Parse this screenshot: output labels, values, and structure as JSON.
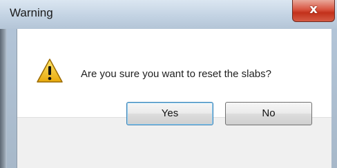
{
  "window": {
    "title": "Warning",
    "close_glyph": "x"
  },
  "dialog": {
    "icon": "warning-icon",
    "message": "Are you sure you want to reset the slabs?"
  },
  "buttons": {
    "yes_label": "Yes",
    "no_label": "No"
  },
  "colors": {
    "warning_yellow": "#f5c518",
    "close_red": "#c2311b",
    "default_button_border": "#3c7fb1"
  }
}
